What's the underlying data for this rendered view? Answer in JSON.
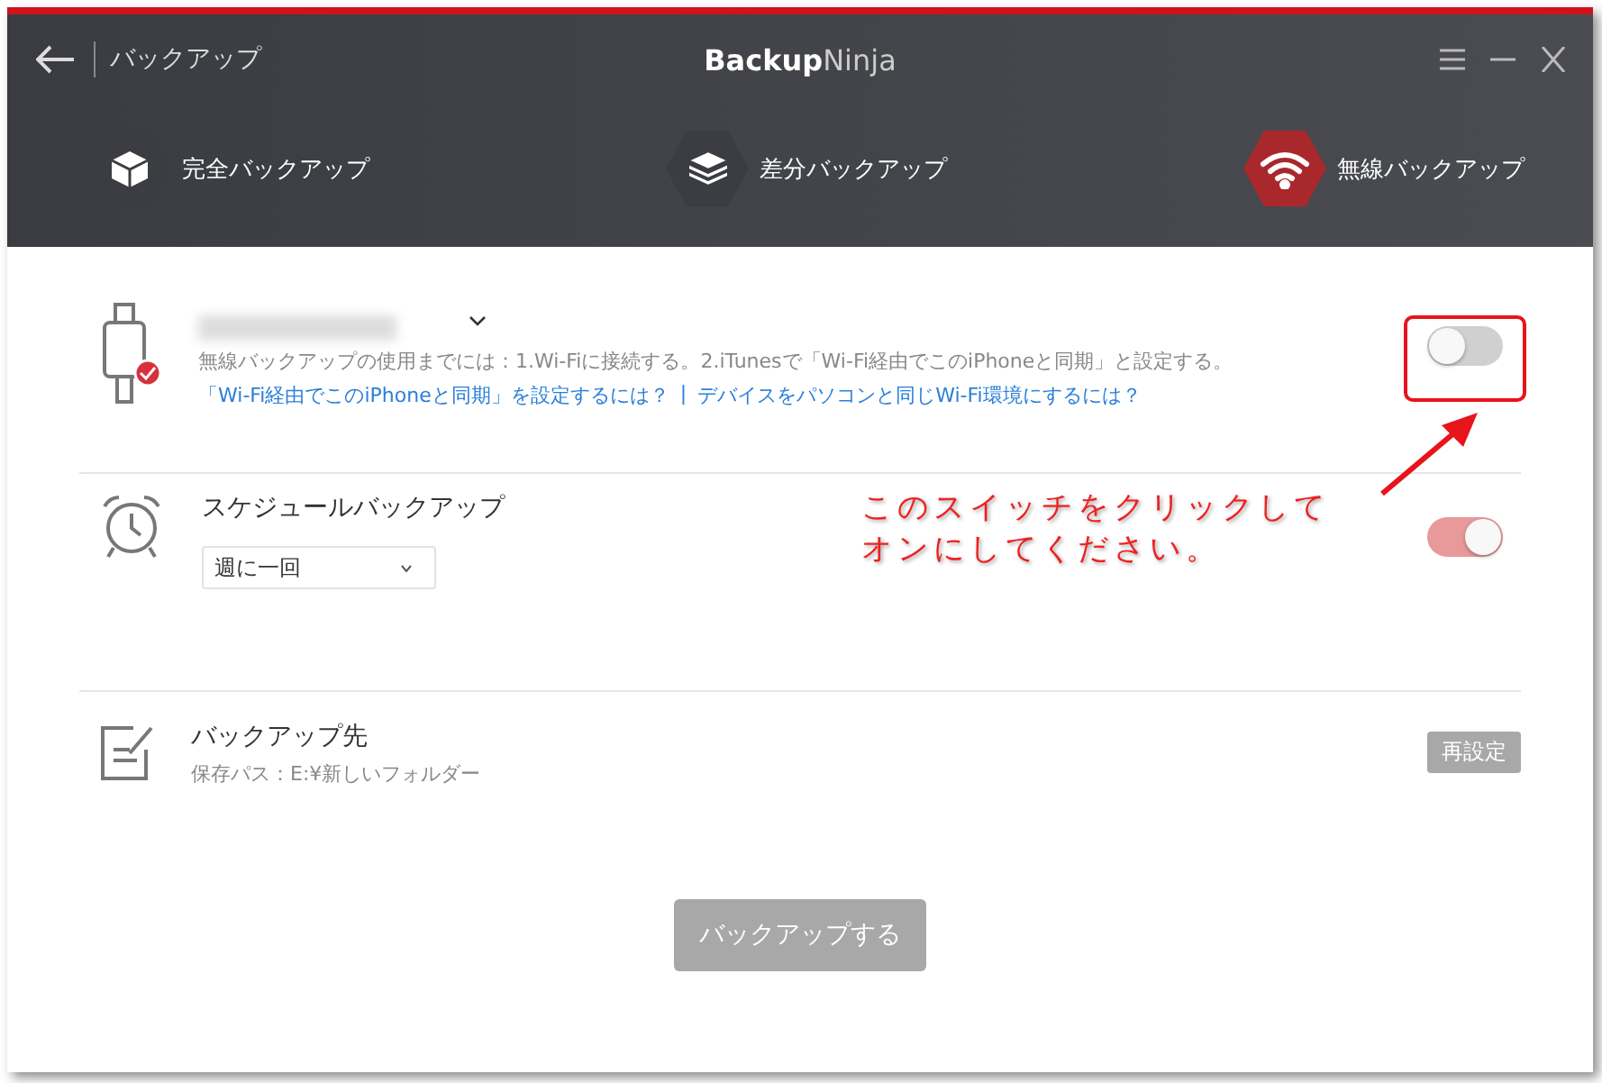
{
  "header": {
    "back_label": "バックアップ",
    "app_title": "**Backup**Ninja"
  },
  "modes": [
    {
      "kind": "full",
      "label": "完全バックアップ",
      "selected": false
    },
    {
      "kind": "diff",
      "label": "差分バックアップ",
      "selected": false
    },
    {
      "kind": "wireless",
      "label": "無線バックアップ",
      "selected": true
    }
  ],
  "device": {
    "on": false,
    "instructions": "無線バックアップの使用までには：1.Wi-Fiに接続する。2.iTunesで「Wi-Fi経由でこのiPhoneと同期」と設定する。",
    "links": [
      "「Wi-Fi経由でこのiPhoneと同期」を設定するには？",
      "デバイスをパソコンと同じWi-Fi環境にするには？"
    ],
    "link_separator": "|"
  },
  "schedule": {
    "title": "スケジュールバックアップ",
    "on": true,
    "frequency": "週に一回"
  },
  "destination": {
    "title": "バックアップ先",
    "path": "保存パス：E:¥新しいフォルダー",
    "reset_button": "再設定"
  },
  "backup_button": "バックアップする",
  "annotation": {
    "lines": [
      "このスイッチをクリックして",
      "オンにしてください。"
    ]
  }
}
